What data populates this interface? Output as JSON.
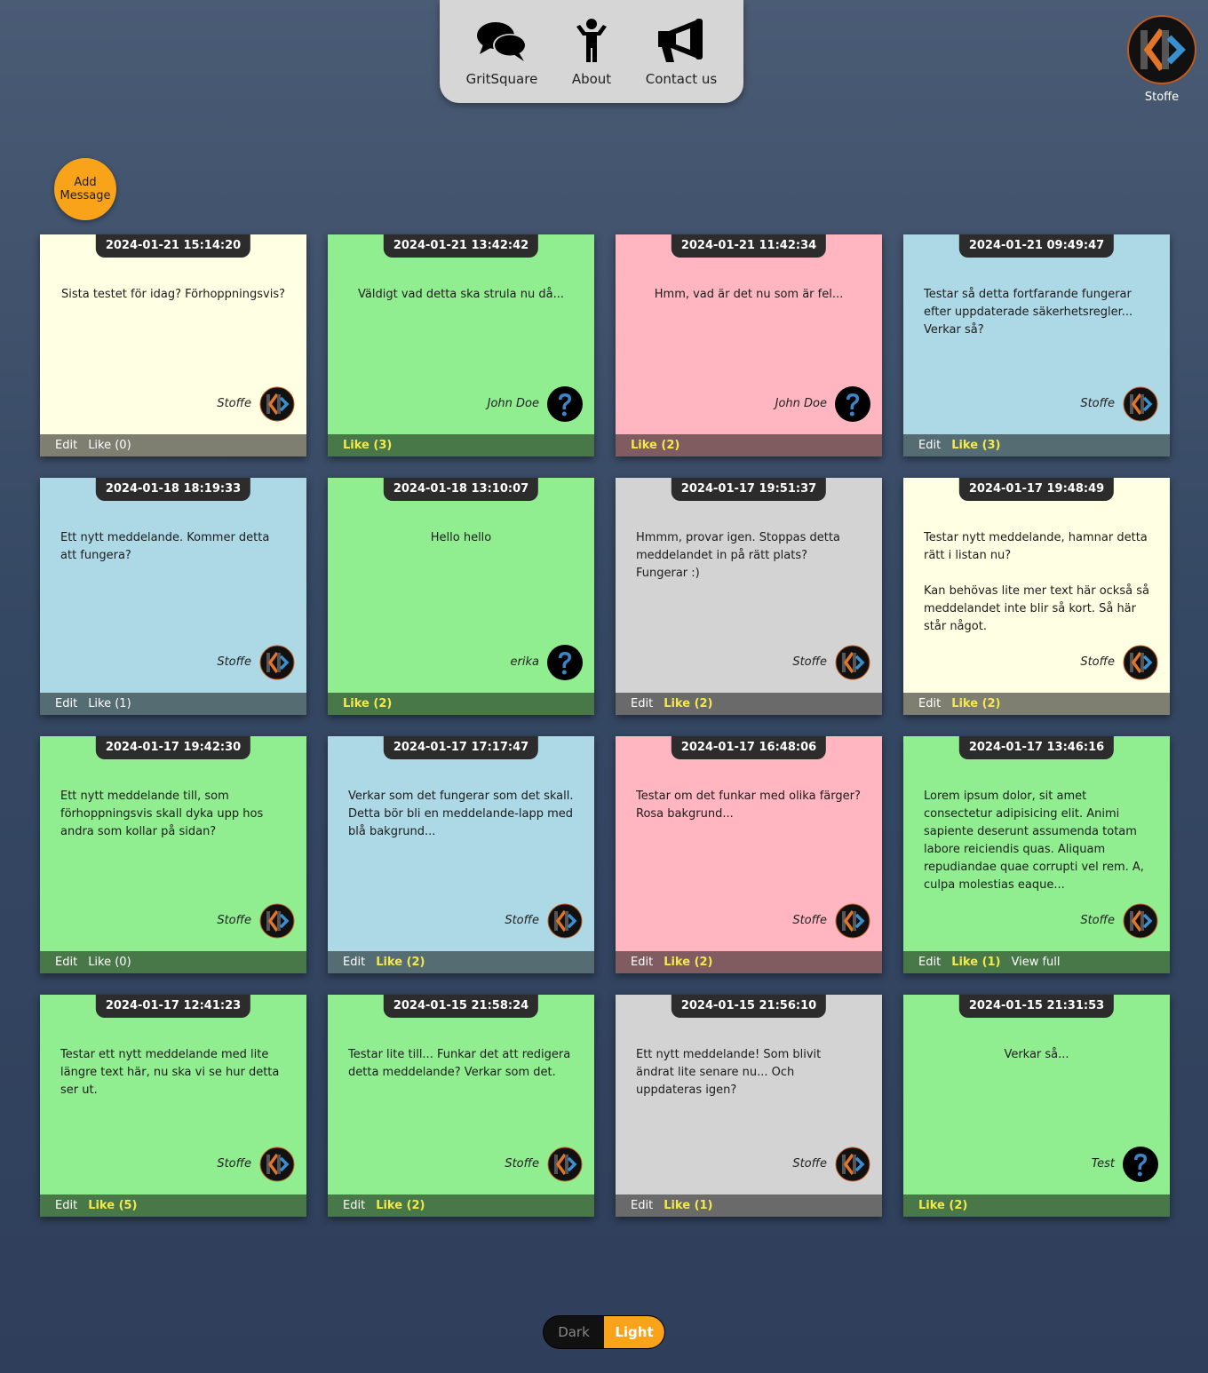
{
  "nav": {
    "items": [
      {
        "label": "GritSquare",
        "icon": "chat-bubbles-icon"
      },
      {
        "label": "About",
        "icon": "person-icon"
      },
      {
        "label": "Contact us",
        "icon": "megaphone-icon"
      }
    ]
  },
  "profile": {
    "name": "Stoffe",
    "avatar": "kb-logo-icon"
  },
  "add_button": {
    "line1": "Add",
    "line2": "Message"
  },
  "colors": {
    "yellow": "#ffffe3",
    "green": "#90ee90",
    "pink": "#ffb6c1",
    "blue": "#add8e6",
    "gray": "#d3d3d3",
    "accent": "#f9a31a",
    "like": "#f4e94a"
  },
  "notes": [
    {
      "date": "2024-01-21 15:14:20",
      "text": "Sista testet för idag? Förhoppningsvis?",
      "author": "Stoffe",
      "avatar": "kb-logo",
      "color": "yellow",
      "actions": [
        "Edit",
        "Like (0)"
      ],
      "like_active": false
    },
    {
      "date": "2024-01-21 13:42:42",
      "text": "Väldigt vad detta ska strula nu då...",
      "author": "John Doe",
      "avatar": "question",
      "color": "green",
      "actions": [
        "Like (3)"
      ],
      "like_active": true
    },
    {
      "date": "2024-01-21 11:42:34",
      "text": "Hmm, vad är det nu som är fel...",
      "author": "John Doe",
      "avatar": "question",
      "color": "pink",
      "actions": [
        "Like (2)"
      ],
      "like_active": true
    },
    {
      "date": "2024-01-21 09:49:47",
      "text": "Testar så detta fortfarande fungerar efter uppdaterade säkerhetsregler... Verkar så?",
      "author": "Stoffe",
      "avatar": "kb-logo",
      "color": "blue",
      "actions": [
        "Edit",
        "Like (3)"
      ],
      "like_active": true
    },
    {
      "date": "2024-01-18 18:19:33",
      "text": "Ett nytt meddelande. Kommer detta att fungera?",
      "author": "Stoffe",
      "avatar": "kb-logo",
      "color": "blue",
      "actions": [
        "Edit",
        "Like (1)"
      ],
      "like_active": false
    },
    {
      "date": "2024-01-18 13:10:07",
      "text": "Hello hello",
      "author": "erika",
      "avatar": "question",
      "color": "green",
      "actions": [
        "Like (2)"
      ],
      "like_active": true
    },
    {
      "date": "2024-01-17 19:51:37",
      "text": "Hmmm, provar igen. Stoppas detta meddelandet in på rätt plats? Fungerar :)",
      "author": "Stoffe",
      "avatar": "kb-logo",
      "color": "gray",
      "actions": [
        "Edit",
        "Like (2)"
      ],
      "like_active": true
    },
    {
      "date": "2024-01-17 19:48:49",
      "text": "Testar nytt meddelande, hamnar detta rätt i listan nu?\n\nKan behövas lite mer text här också så meddelandet inte blir så kort. Så här står något.",
      "author": "Stoffe",
      "avatar": "kb-logo",
      "color": "yellow",
      "actions": [
        "Edit",
        "Like (2)"
      ],
      "like_active": true
    },
    {
      "date": "2024-01-17 19:42:30",
      "text": "Ett nytt meddelande till, som förhoppningsvis skall dyka upp hos andra som kollar på sidan?",
      "author": "Stoffe",
      "avatar": "kb-logo",
      "color": "green",
      "actions": [
        "Edit",
        "Like (0)"
      ],
      "like_active": false
    },
    {
      "date": "2024-01-17 17:17:47",
      "text": "Verkar som det fungerar som det skall. Detta bör bli en meddelande-lapp med blå bakgrund...",
      "author": "Stoffe",
      "avatar": "kb-logo",
      "color": "blue",
      "actions": [
        "Edit",
        "Like (2)"
      ],
      "like_active": true
    },
    {
      "date": "2024-01-17 16:48:06",
      "text": "Testar om det funkar med olika färger? Rosa bakgrund...",
      "author": "Stoffe",
      "avatar": "kb-logo",
      "color": "pink",
      "actions": [
        "Edit",
        "Like (2)"
      ],
      "like_active": true
    },
    {
      "date": "2024-01-17 13:46:16",
      "text": "Lorem ipsum dolor, sit amet consectetur adipisicing elit. Animi sapiente deserunt assumenda totam labore reiciendis quas. Aliquam repudiandae quae corrupti vel rem. A, culpa molestias eaque...",
      "author": "Stoffe",
      "avatar": "kb-logo",
      "color": "green",
      "actions": [
        "Edit",
        "Like (1)",
        "View full"
      ],
      "like_active": true
    },
    {
      "date": "2024-01-17 12:41:23",
      "text": "Testar ett nytt meddelande med lite längre text här, nu ska vi se hur detta ser ut.",
      "author": "Stoffe",
      "avatar": "kb-logo",
      "color": "green",
      "actions": [
        "Edit",
        "Like (5)"
      ],
      "like_active": true
    },
    {
      "date": "2024-01-15 21:58:24",
      "text": "Testar lite till... Funkar det att redigera detta meddelande? Verkar som det.",
      "author": "Stoffe",
      "avatar": "kb-logo",
      "color": "green",
      "actions": [
        "Edit",
        "Like (2)"
      ],
      "like_active": true
    },
    {
      "date": "2024-01-15 21:56:10",
      "text": "Ett nytt meddelande! Som blivit ändrat lite senare nu... Och uppdateras igen?",
      "author": "Stoffe",
      "avatar": "kb-logo",
      "color": "gray",
      "actions": [
        "Edit",
        "Like (1)"
      ],
      "like_active": true
    },
    {
      "date": "2024-01-15 21:31:53",
      "text": "Verkar så...",
      "author": "Test",
      "avatar": "question",
      "color": "green",
      "actions": [
        "Like (2)"
      ],
      "like_active": true
    }
  ],
  "theme_toggle": {
    "dark_label": "Dark",
    "light_label": "Light",
    "selected": "Light"
  }
}
